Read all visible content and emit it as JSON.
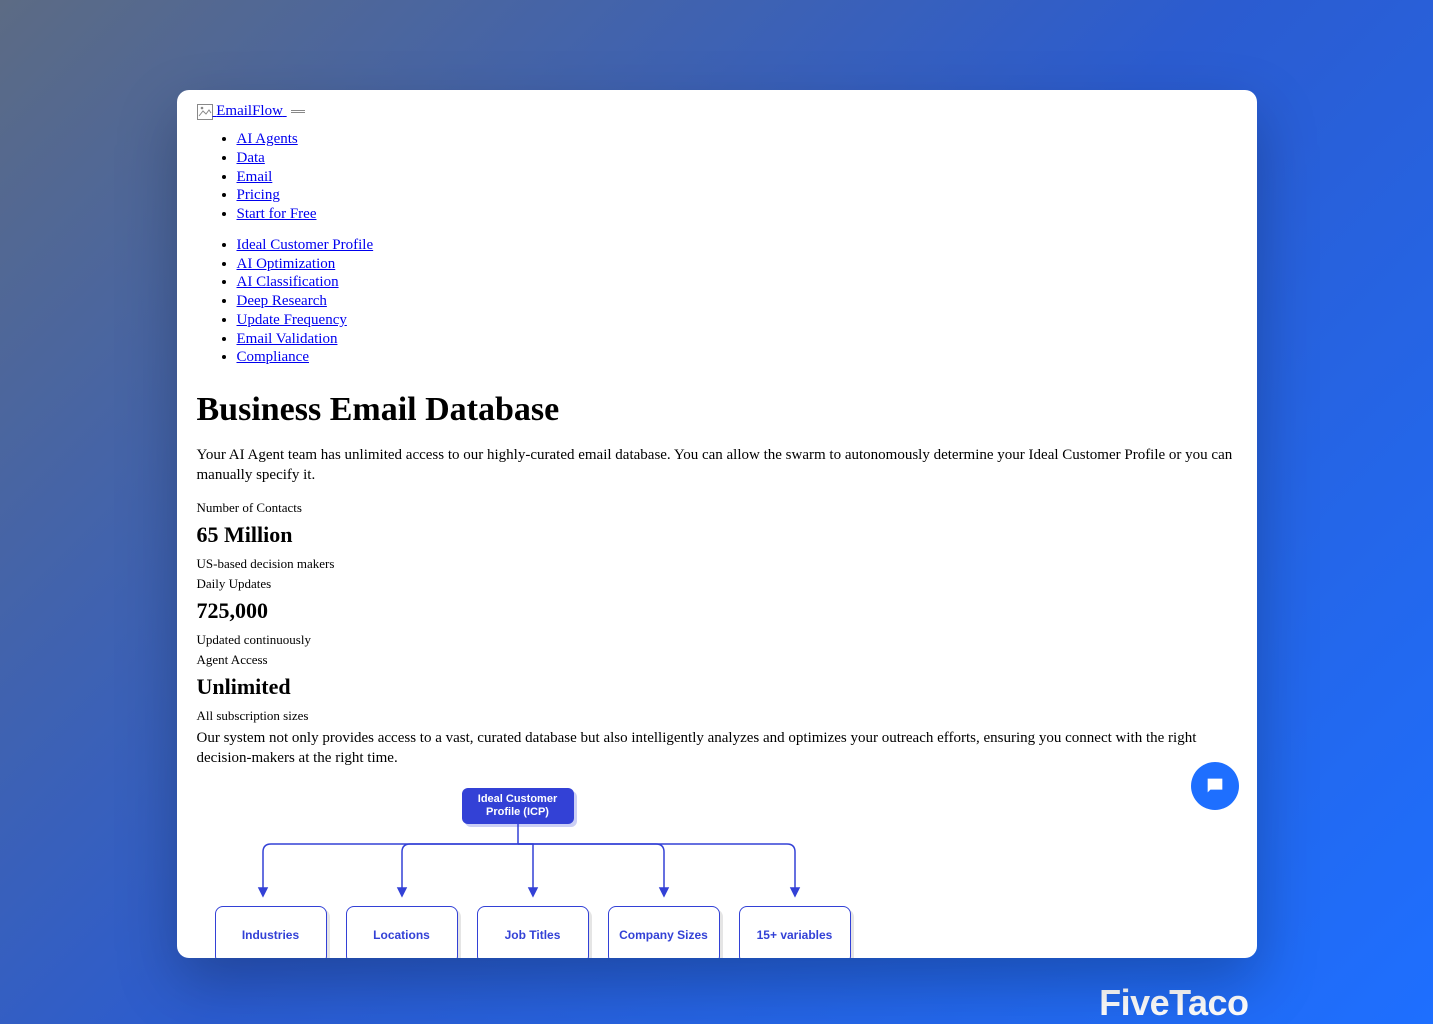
{
  "logo_alt": "EmailFlow",
  "nav": {
    "items": [
      {
        "label": "AI Agents"
      },
      {
        "label": "Data"
      },
      {
        "label": "Email"
      },
      {
        "label": "Pricing"
      },
      {
        "label": "Start for Free"
      }
    ]
  },
  "subnav": {
    "items": [
      {
        "label": "Ideal Customer Profile"
      },
      {
        "label": "AI Optimization"
      },
      {
        "label": "AI Classification"
      },
      {
        "label": "Deep Research"
      },
      {
        "label": "Update Frequency"
      },
      {
        "label": "Email Validation"
      },
      {
        "label": "Compliance"
      }
    ]
  },
  "title": "Business Email Database",
  "intro": "Your AI Agent team has unlimited access to our highly-curated email database. You can allow the swarm to autonomously determine your Ideal Customer Profile or you can manually specify it.",
  "stats": [
    {
      "label": "Number of Contacts",
      "value": "65 Million",
      "sub": "US-based decision makers"
    },
    {
      "label": "Daily Updates",
      "value": "725,000",
      "sub": "Updated continuously"
    },
    {
      "label": "Agent Access",
      "value": "Unlimited",
      "sub": "All subscription sizes"
    }
  ],
  "outro": "Our system not only provides access to a vast, curated database but also intelligently analyzes and optimizes your outreach efforts, ensuring you connect with the right decision-makers at the right time.",
  "diagram": {
    "root": "Ideal Customer Profile (ICP)",
    "children": [
      "Industries",
      "Locations",
      "Job Titles",
      "Company Sizes",
      "15+ variables"
    ]
  },
  "brand": "FiveTaco"
}
